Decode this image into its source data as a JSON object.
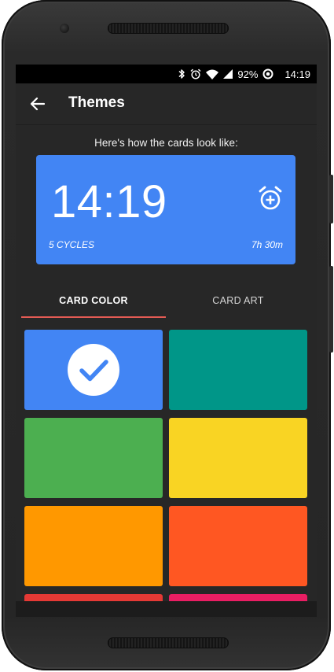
{
  "status_bar": {
    "battery": "92%",
    "time": "14:19",
    "icons": [
      "bluetooth-icon",
      "alarm-clock-icon",
      "wifi-icon",
      "cell-signal-icon",
      "sync-icon"
    ]
  },
  "app_bar": {
    "title": "Themes",
    "back_icon": "arrow-left-icon"
  },
  "preview": {
    "label": "Here's how the cards look like:",
    "time": "14:19",
    "cycles": "5 CYCLES",
    "duration": "7h 30m",
    "icon": "alarm-add-icon",
    "color": "#4285f4"
  },
  "tabs": [
    {
      "label": "CARD COLOR",
      "selected": true
    },
    {
      "label": "CARD ART",
      "selected": false
    }
  ],
  "tab_indicator_color": "#e35b54",
  "colors": {
    "selected_index": 0,
    "check_icon": "checkmark-circle-icon",
    "swatches": [
      "#4285f4",
      "#009688",
      "#4caf50",
      "#f9d423",
      "#ff9800",
      "#ff5722",
      "#e53935",
      "#e91e63"
    ]
  }
}
